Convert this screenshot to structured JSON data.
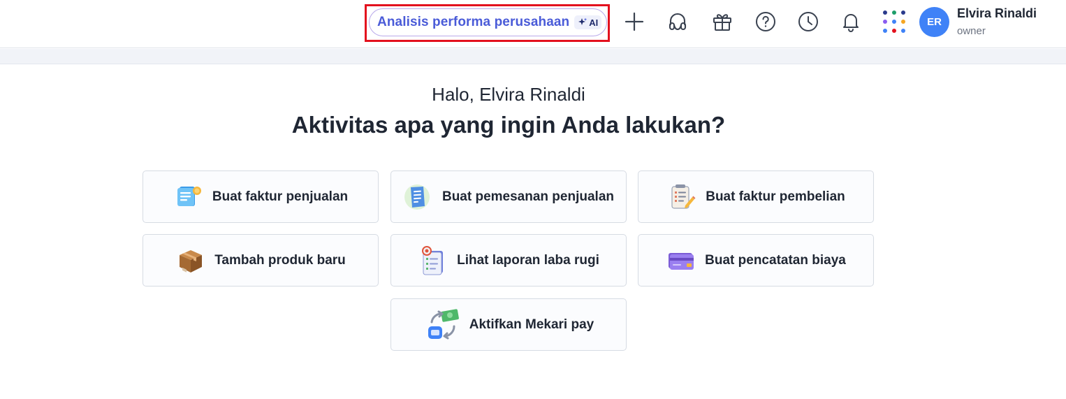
{
  "header": {
    "ai_pill": {
      "label": "Analisis performa perusahaan",
      "badge": "AI"
    },
    "icons": [
      "plus-icon",
      "headset-icon",
      "gift-icon",
      "help-icon",
      "clock-icon",
      "bell-icon",
      "apps-grid-icon"
    ],
    "user": {
      "initials": "ER",
      "name": "Elvira Rinaldi",
      "role": "owner"
    }
  },
  "main": {
    "greeting": "Halo, Elvira Rinaldi",
    "headline": "Aktivitas apa yang ingin Anda lakukan?",
    "actions": [
      {
        "label": "Buat faktur penjualan",
        "icon": "sales-invoice-icon"
      },
      {
        "label": "Buat pemesanan penjualan",
        "icon": "sales-order-icon"
      },
      {
        "label": "Buat faktur pembelian",
        "icon": "purchase-invoice-icon"
      },
      {
        "label": "Tambah produk baru",
        "icon": "product-box-icon"
      },
      {
        "label": "Lihat laporan laba rugi",
        "icon": "profit-loss-report-icon"
      },
      {
        "label": "Buat pencatatan biaya",
        "icon": "expense-card-icon"
      },
      {
        "label": "Aktifkan Mekari pay",
        "icon": "mekari-pay-icon"
      }
    ]
  },
  "colors": {
    "accent": "#4a5bd8",
    "highlight": "#e3111e",
    "avatar": "#3f82f7"
  }
}
